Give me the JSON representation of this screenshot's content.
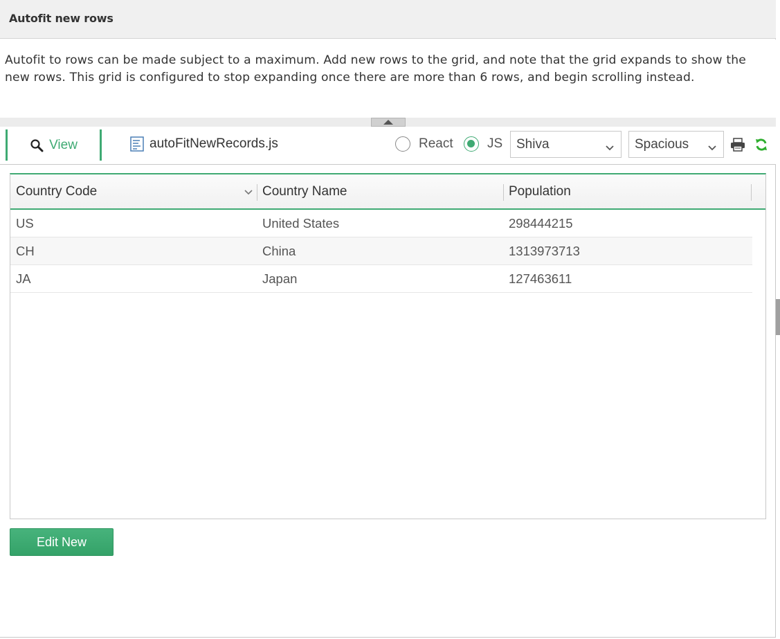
{
  "page": {
    "title": "Autofit new rows",
    "description": "Autofit to rows can be made subject to a maximum. Add new rows to the grid, and note that the grid expands to show the new rows. This grid is configured to stop expanding once there are more than 6 rows, and begin scrolling instead."
  },
  "toolbar": {
    "view_tab_label": "View",
    "file_tab_label": "autoFitNewRecords.js",
    "radio_react_label": "React",
    "radio_js_label": "JS",
    "radio_selected": "JS",
    "skin_select_value": "Shiva",
    "density_select_value": "Spacious",
    "icons": [
      "search-icon",
      "file-code-icon",
      "chevron-down-icon",
      "print-icon",
      "refresh-icon"
    ]
  },
  "grid": {
    "columns": [
      "Country Code",
      "Country Name",
      "Population"
    ],
    "rows": [
      {
        "code": "US",
        "name": "United States",
        "population": "298444215"
      },
      {
        "code": "CH",
        "name": "China",
        "population": "1313973713"
      },
      {
        "code": "JA",
        "name": "Japan",
        "population": "127463611"
      }
    ]
  },
  "actions": {
    "edit_new_label": "Edit New"
  },
  "colors": {
    "accent": "#3faa73",
    "title_bar": "#f0f0f0",
    "row_alt": "#f7f7f7"
  }
}
